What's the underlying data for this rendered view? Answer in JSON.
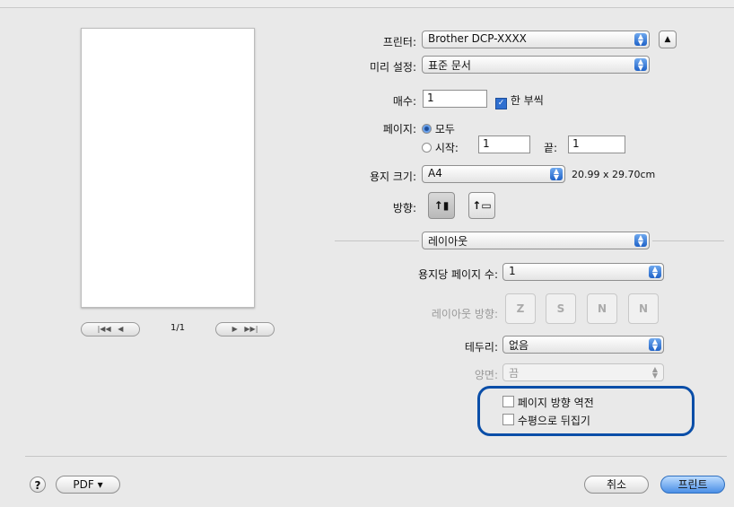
{
  "printer": {
    "label": "프린터:",
    "value": "Brother DCP-XXXX"
  },
  "preset": {
    "label": "미리 설정:",
    "value": "표준 문서"
  },
  "copies": {
    "label": "매수:",
    "value": "1",
    "collated_label": "한 부씩",
    "collated": true
  },
  "pages": {
    "label": "페이지:",
    "all_label": "모두",
    "from_label": "시작:",
    "from_value": "1",
    "to_label": "끝:",
    "to_value": "1"
  },
  "paper_size": {
    "label": "용지 크기:",
    "value": "A4",
    "dims": "20.99 x 29.70cm"
  },
  "orientation": {
    "label": "방향:",
    "portrait_glyph": "↑▮",
    "landscape_glyph": "↑▭"
  },
  "pane_popup": {
    "value": "레이아웃"
  },
  "layout": {
    "pages_per_sheet": {
      "label": "용지당 페이지 수:",
      "value": "1"
    },
    "direction": {
      "label": "레이아웃 방향:",
      "glyphs": [
        "Z",
        "S",
        "N",
        "N"
      ]
    },
    "border": {
      "label": "테두리:",
      "value": "없음"
    },
    "two_sided": {
      "label": "양면:",
      "value": "끔"
    },
    "reverse_label": "페이지 방향 역전",
    "flip_label": "수평으로 뒤집기"
  },
  "preview_nav": {
    "first": "|◀◀",
    "prev": "◀",
    "page": "1/1",
    "next": "▶",
    "last": "▶▶|"
  },
  "footer": {
    "help": "?",
    "pdf": "PDF ▾",
    "cancel": "취소",
    "print": "프린트"
  },
  "colors": {
    "accent": "#2f6fd0",
    "highlight": "#0a4ea8"
  }
}
